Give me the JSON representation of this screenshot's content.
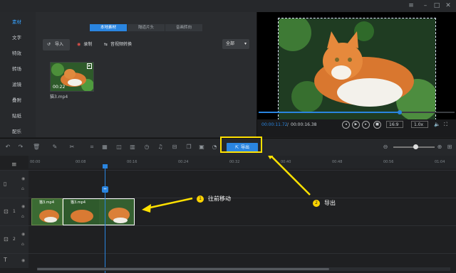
{
  "sidebar": {
    "items": [
      {
        "label": "素材",
        "active": true
      },
      {
        "label": "文字"
      },
      {
        "label": "特效"
      },
      {
        "label": "转场"
      },
      {
        "label": "滤镜"
      },
      {
        "label": "叠附"
      },
      {
        "label": "贴纸"
      },
      {
        "label": "配乐"
      }
    ]
  },
  "media": {
    "tabs": [
      "本地素材",
      "隔道片头",
      "音画转向"
    ],
    "import_label": "导入",
    "record_label": "录制",
    "convert_label": "音视频转换",
    "filter_value": "全部",
    "clip": {
      "duration": "00:22",
      "filename": "猫3.mp4"
    }
  },
  "preview": {
    "current_time": "00:00:11.72",
    "total_time": "00:00:16.38",
    "aspect": "16:9",
    "speed": "1.0x"
  },
  "toolbar": {
    "export_label": "导出"
  },
  "timeline": {
    "ruler_labels": [
      "00:00",
      "00:08",
      "00:16",
      "00:24",
      "00:32",
      "00:40",
      "00:48",
      "00:56",
      "01:04"
    ],
    "clips": [
      "猫3.mp4",
      "猫3.mp4"
    ],
    "track_numbers": [
      "1",
      "1",
      "2"
    ]
  },
  "annotations": [
    {
      "num": "1",
      "text": "往前移动"
    },
    {
      "num": "2",
      "text": "导出"
    }
  ],
  "colors": {
    "accent": "#2a85e0",
    "highlight": "#ffe100"
  }
}
